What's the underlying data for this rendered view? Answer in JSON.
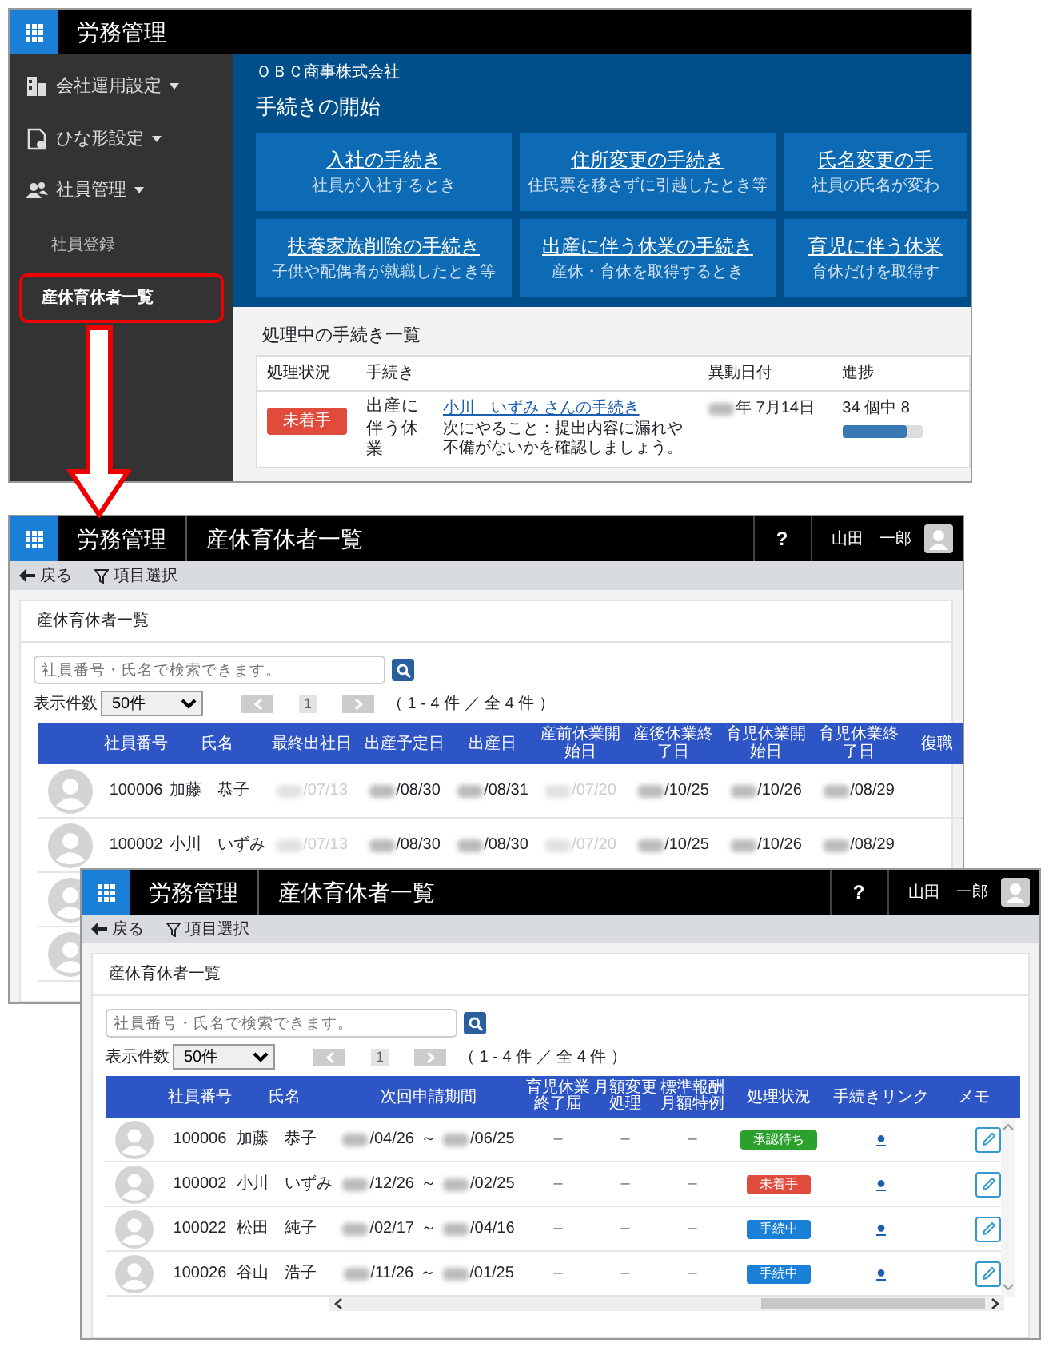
{
  "portal": {
    "app_title": "労務管理",
    "sidebar": [
      {
        "label": "会社運用設定",
        "kind": "menu",
        "highlighted": false
      },
      {
        "label": "ひな形設定",
        "kind": "menu",
        "highlighted": false
      },
      {
        "label": "社員管理",
        "kind": "menu",
        "highlighted": false
      },
      {
        "label": "社員登録",
        "kind": "sub",
        "highlighted": false
      },
      {
        "label": "産休育休者一覧",
        "kind": "sub",
        "highlighted": true
      }
    ],
    "company": "ＯＢＣ商事株式会社",
    "section_title": "手続きの開始",
    "tiles": [
      {
        "title": "入社の手続き",
        "subtitle": "社員が入社するとき"
      },
      {
        "title": "住所変更の手続き",
        "subtitle": "住民票を移さずに引越したとき等"
      },
      {
        "title": "氏名変更の手",
        "subtitle": "社員の氏名が変わ"
      },
      {
        "title": "扶養家族削除の手続き",
        "subtitle": "子供や配偶者が就職したとき等"
      },
      {
        "title": "出産に伴う休業の手続き",
        "subtitle": "産休・育休を取得するとき"
      },
      {
        "title": "育児に伴う休業",
        "subtitle": "育休だけを取得す"
      }
    ],
    "pending": {
      "title": "処理中の手続き一覧",
      "columns": [
        "処理状況",
        "手続き",
        "異動日付",
        "進捗"
      ],
      "rows": [
        {
          "status": {
            "label": "未着手",
            "color": "#e04b3c"
          },
          "procedure": "出産に伴う休業",
          "link": "小川　いずみ さんの手続き",
          "next": "次にやること：提出内容に漏れや不備がないかを確認しましょう。",
          "date": "年 7月14日",
          "progress": "34 個中 8",
          "level": 0.8
        }
      ]
    }
  },
  "list_window": {
    "app_title": "労務管理",
    "page_title": "産休育休者一覧",
    "help": "?",
    "user": "山田　一郎",
    "back": "戻る",
    "filter": "項目選択",
    "card_title": "産休育休者一覧",
    "search_placeholder": "社員番号・氏名で検索できます。",
    "per_page_label": "表示件数",
    "per_page": "50件",
    "page": "1",
    "range": "（ 1 - 4 件 ／ 全 4 件 ）",
    "columns": [
      "社員番号",
      "氏名",
      "最終出社日",
      "出産予定日",
      "出産日",
      "産前休業開始日",
      "産後休業終了日",
      "育児休業開始日",
      "育児休業終了日",
      "復職"
    ],
    "rows": [
      {
        "kind": "full",
        "id": "100006",
        "name": "加藤　恭子",
        "dates": [
          {
            "text": "/07/13",
            "faint": true
          },
          {
            "text": "/08/30",
            "faint": false
          },
          {
            "text": "/08/31",
            "faint": false
          },
          {
            "text": "/07/20",
            "faint": true
          },
          {
            "text": "/10/25",
            "faint": false
          },
          {
            "text": "/10/26",
            "faint": false
          },
          {
            "text": "/08/29",
            "faint": false
          }
        ]
      },
      {
        "kind": "full",
        "id": "100002",
        "name": "小川　いずみ",
        "dates": [
          {
            "text": "/07/13",
            "faint": true
          },
          {
            "text": "/08/30",
            "faint": false
          },
          {
            "text": "/08/30",
            "faint": false
          },
          {
            "text": "/07/20",
            "faint": true
          },
          {
            "text": "/10/25",
            "faint": false
          },
          {
            "text": "/10/26",
            "faint": false
          },
          {
            "text": "/08/29",
            "faint": false
          }
        ]
      },
      {
        "kind": "avatar_only"
      },
      {
        "kind": "avatar_only"
      }
    ]
  },
  "detail_window": {
    "app_title": "労務管理",
    "page_title": "産休育休者一覧",
    "help": "?",
    "user": "山田　一郎",
    "back": "戻る",
    "filter": "項目選択",
    "card_title": "産休育休者一覧",
    "search_placeholder": "社員番号・氏名で検索できます。",
    "per_page_label": "表示件数",
    "per_page": "50件",
    "page": "1",
    "range": "（ 1 - 4 件 ／ 全 4 件 ）",
    "columns": [
      "社員番号",
      "氏名",
      "次回申請期間",
      "育児休業終了届",
      "月額変更処理",
      "標準報酬月額特例",
      "処理状況",
      "手続きリンク",
      "メモ"
    ],
    "rows": [
      {
        "id": "100006",
        "name": "加藤　恭子",
        "start": "/04/26",
        "sep": "～",
        "end": "/06/25",
        "flags": [
          "–",
          "–",
          "–"
        ],
        "status": {
          "label": "承認待ち",
          "color": "#2ca02c"
        },
        "link": "●"
      },
      {
        "id": "100002",
        "name": "小川　いずみ",
        "start": "/12/26",
        "sep": "～",
        "end": "/02/25",
        "flags": [
          "–",
          "–",
          "–"
        ],
        "status": {
          "label": "未着手",
          "color": "#e04b3c"
        },
        "link": "●"
      },
      {
        "id": "100022",
        "name": "松田　純子",
        "start": "/02/17",
        "sep": "～",
        "end": "/04/16",
        "flags": [
          "–",
          "–",
          "–"
        ],
        "status": {
          "label": "手続中",
          "color": "#1a7fd6"
        },
        "link": "●"
      },
      {
        "id": "100026",
        "name": "谷山　浩子",
        "start": "/11/26",
        "sep": "～",
        "end": "/01/25",
        "flags": [
          "–",
          "–",
          "–"
        ],
        "status": {
          "label": "手続中",
          "color": "#1a7fd6"
        },
        "link": "●"
      }
    ]
  }
}
